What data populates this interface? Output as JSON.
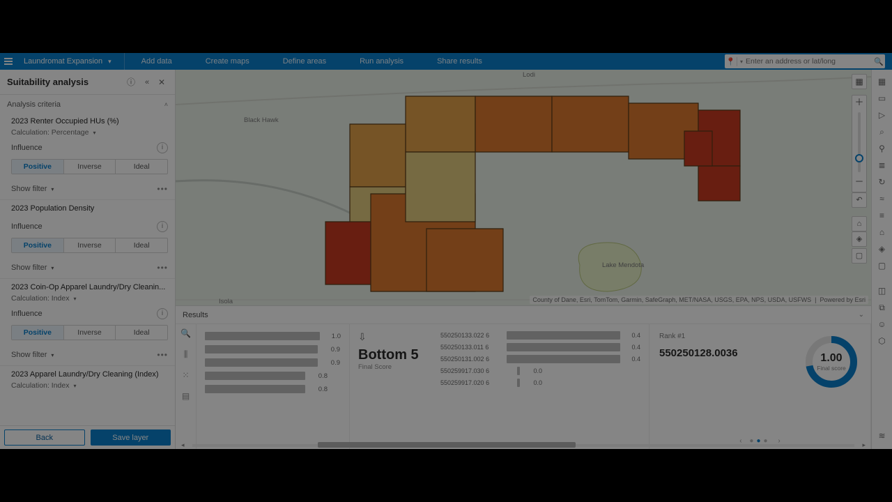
{
  "toolbar": {
    "brand": "Laundromat Expansion",
    "tabs": [
      "Add data",
      "Create maps",
      "Define areas",
      "Run analysis",
      "Share results"
    ],
    "search_placeholder": "Enter an address or lat/long"
  },
  "panel": {
    "title": "Suitability analysis",
    "section": "Analysis criteria",
    "influence_label": "Influence",
    "influence_opts": [
      "Positive",
      "Inverse",
      "Ideal"
    ],
    "show_filter": "Show filter",
    "back": "Back",
    "save": "Save layer",
    "criteria": [
      {
        "name": "2023 Renter Occupied HUs (%)",
        "calc": "Calculation: Percentage"
      },
      {
        "name": "2023 Population Density",
        "calc": ""
      },
      {
        "name": "2023 Coin-Op Apparel Laundry/Dry Cleanin...",
        "calc": "Calculation: Index"
      },
      {
        "name": "2023 Apparel Laundry/Dry Cleaning (Index)",
        "calc": "Calculation: Index"
      }
    ]
  },
  "map": {
    "labels": {
      "lodi": "Lodi",
      "blackhawk": "Black Hawk",
      "isola": "Isola",
      "mendota": "Lake Mendota"
    },
    "attrib_left": "County of Dane, Esri, TomTom, Garmin, SafeGraph,   MET/NASA, USGS, EPA, NPS, USDA, USFWS",
    "attrib_right": "Powered by Esri",
    "colors": {
      "low": "#e3cc7f",
      "mid": "#e2a24a",
      "high": "#dd7a2e",
      "top": "#c83a22"
    }
  },
  "results": {
    "title": "Results",
    "view_icons": [
      "magnify",
      "histogram",
      "scatter",
      "table"
    ],
    "chart_data": {
      "type": "bar",
      "top_values": [
        1.0,
        0.9,
        0.9,
        0.8,
        0.8
      ],
      "bottom5": {
        "title": "Bottom 5",
        "subtitle": "Final Score",
        "items": [
          {
            "id": "550250133.022 6",
            "v": 0.4
          },
          {
            "id": "550250133.011 6",
            "v": 0.4
          },
          {
            "id": "550250131.002 6",
            "v": 0.4
          },
          {
            "id": "550259917.030 6",
            "v": 0.0
          },
          {
            "id": "550259917.020 6",
            "v": 0.0
          }
        ]
      },
      "rank_card": {
        "rank_label": "Rank #1",
        "id": "550250128.0036",
        "score": "1.00",
        "score_label": "Final score",
        "progress": 0.72
      }
    }
  },
  "rail_icons": [
    "layers-icon",
    "pointer-icon",
    "play-icon",
    "zoom-in-icon",
    "zoom-area-icon",
    "list-icon",
    "refresh-icon",
    "slider-icon",
    "ruler-icon",
    "home-icon",
    "globe-icon",
    "monitor-icon",
    "",
    "bookmark-icon",
    "window-icon",
    "user-icon",
    "hex-icon",
    "db-icon"
  ],
  "rail_glyphs": [
    "▦",
    "▭",
    "▷",
    "⌕",
    "⚲",
    "≣",
    "↻",
    "≈",
    "≡",
    "⌂",
    "◈",
    "▢",
    "",
    "◫",
    "⧉",
    "☺",
    "⬡",
    "≋"
  ]
}
